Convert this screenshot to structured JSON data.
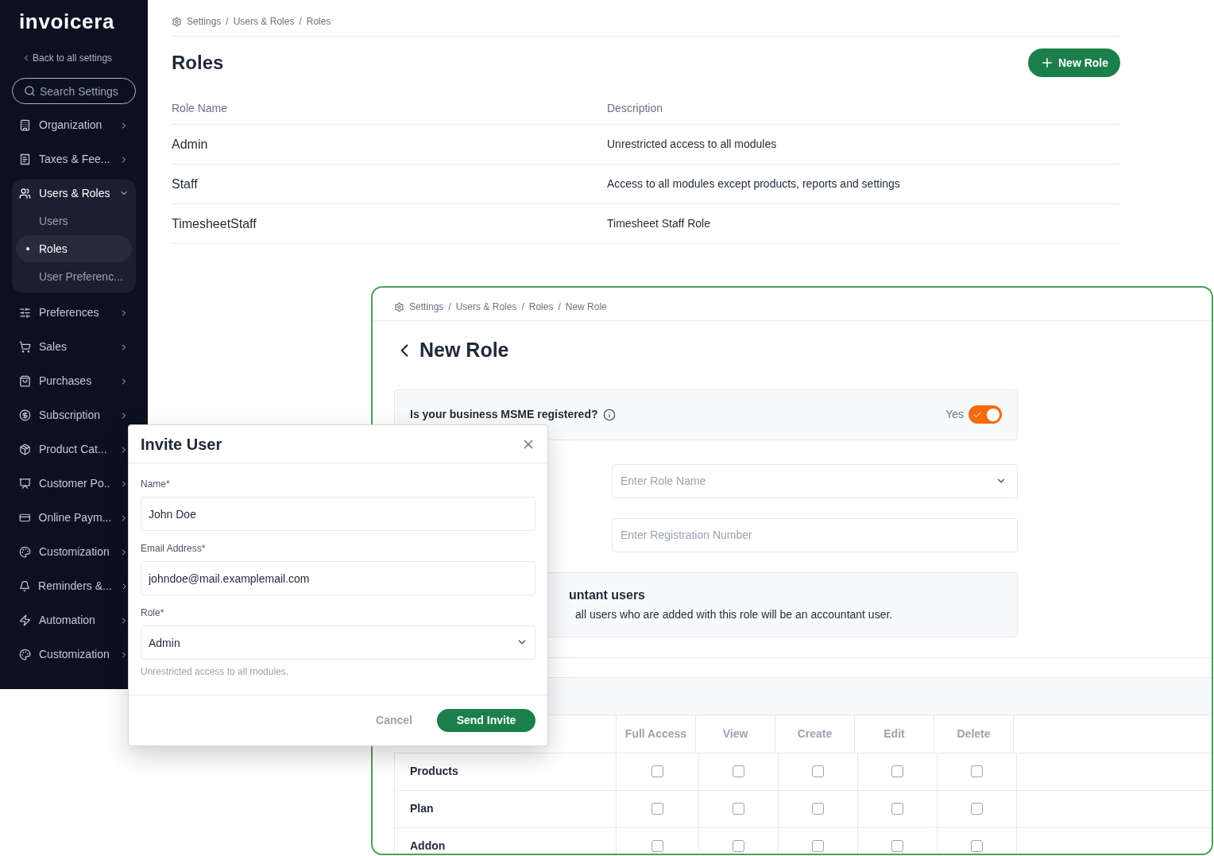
{
  "sidebar": {
    "logo": "invoicera",
    "back_link": "Back to all settings",
    "search": {
      "placeholder": "Search Settings"
    },
    "items": [
      {
        "label": "Organization",
        "expanded": false
      },
      {
        "label": "Taxes & Fee...",
        "expanded": false
      },
      {
        "label": "Users & Roles",
        "expanded": true,
        "children": [
          {
            "label": "Users",
            "selected": false
          },
          {
            "label": "Roles",
            "selected": true
          },
          {
            "label": "User Preferenc...",
            "selected": false
          }
        ]
      },
      {
        "label": "Preferences",
        "expanded": false
      },
      {
        "label": "Sales",
        "expanded": false
      },
      {
        "label": "Purchases",
        "expanded": false
      },
      {
        "label": "Subscription",
        "expanded": false
      },
      {
        "label": "Product Cat...",
        "expanded": false
      },
      {
        "label": "Customer Po..",
        "expanded": false
      },
      {
        "label": "Online Paym...",
        "expanded": false
      },
      {
        "label": "Customization",
        "expanded": false
      },
      {
        "label": "Reminders &...",
        "expanded": false
      },
      {
        "label": "Automation",
        "expanded": false
      },
      {
        "label": "Customization",
        "expanded": false
      }
    ]
  },
  "roles_page": {
    "breadcrumb_separator": "/",
    "breadcrumb": [
      "Settings",
      "Users & Roles",
      "Roles"
    ],
    "title": "Roles",
    "new_role_button": "New Role",
    "columns": [
      "Role Name",
      "Description"
    ],
    "rows": [
      {
        "name": "Admin",
        "description": "Unrestricted access to all modules"
      },
      {
        "name": "Staff",
        "description": "Access to all modules except products, reports and settings"
      },
      {
        "name": "TimesheetStaff",
        "description": "Timesheet Staff Role"
      }
    ]
  },
  "new_role_panel": {
    "breadcrumb_separator": "/",
    "breadcrumb": [
      "Settings",
      "Users & Roles",
      "Roles",
      "New Role"
    ],
    "title": "New Role",
    "msme": {
      "question": "Is your business MSME registered?",
      "answer": "Yes",
      "on": true
    },
    "role_name_field": {
      "placeholder": "Enter Role Name"
    },
    "registration_field": {
      "placeholder": "Enter Registration Number"
    },
    "accountant": {
      "title": "untant users",
      "description": "all users who are added with this role will be an accountant user."
    },
    "permission_columns": [
      "Full Access",
      "View",
      "Create",
      "Edit",
      "Delete"
    ],
    "permission_rows": [
      {
        "module": "Products",
        "permissions": [
          {
            "checked": false
          },
          {
            "checked": false
          },
          {
            "checked": false
          },
          {
            "checked": false
          },
          {
            "checked": false
          }
        ]
      },
      {
        "module": "Plan",
        "permissions": [
          {
            "checked": false
          },
          {
            "checked": false
          },
          {
            "checked": false
          },
          {
            "checked": false
          },
          {
            "checked": false
          }
        ]
      },
      {
        "module": "Addon",
        "permissions": [
          {
            "checked": false
          },
          {
            "checked": false
          },
          {
            "checked": false
          },
          {
            "checked": false
          },
          {
            "checked": false
          }
        ]
      }
    ]
  },
  "invite_dialog": {
    "title": "Invite User",
    "fields": [
      {
        "kind": "text",
        "label": "Name*",
        "value": "John Doe"
      },
      {
        "kind": "text",
        "label": "Email Address*",
        "value": "johndoe@mail.examplemail.com"
      },
      {
        "kind": "select",
        "label": "Role*",
        "value": "Admin",
        "hint": "Unrestricted access to all modules."
      }
    ],
    "cancel_button": "Cancel",
    "send_button": "Send Invite"
  }
}
